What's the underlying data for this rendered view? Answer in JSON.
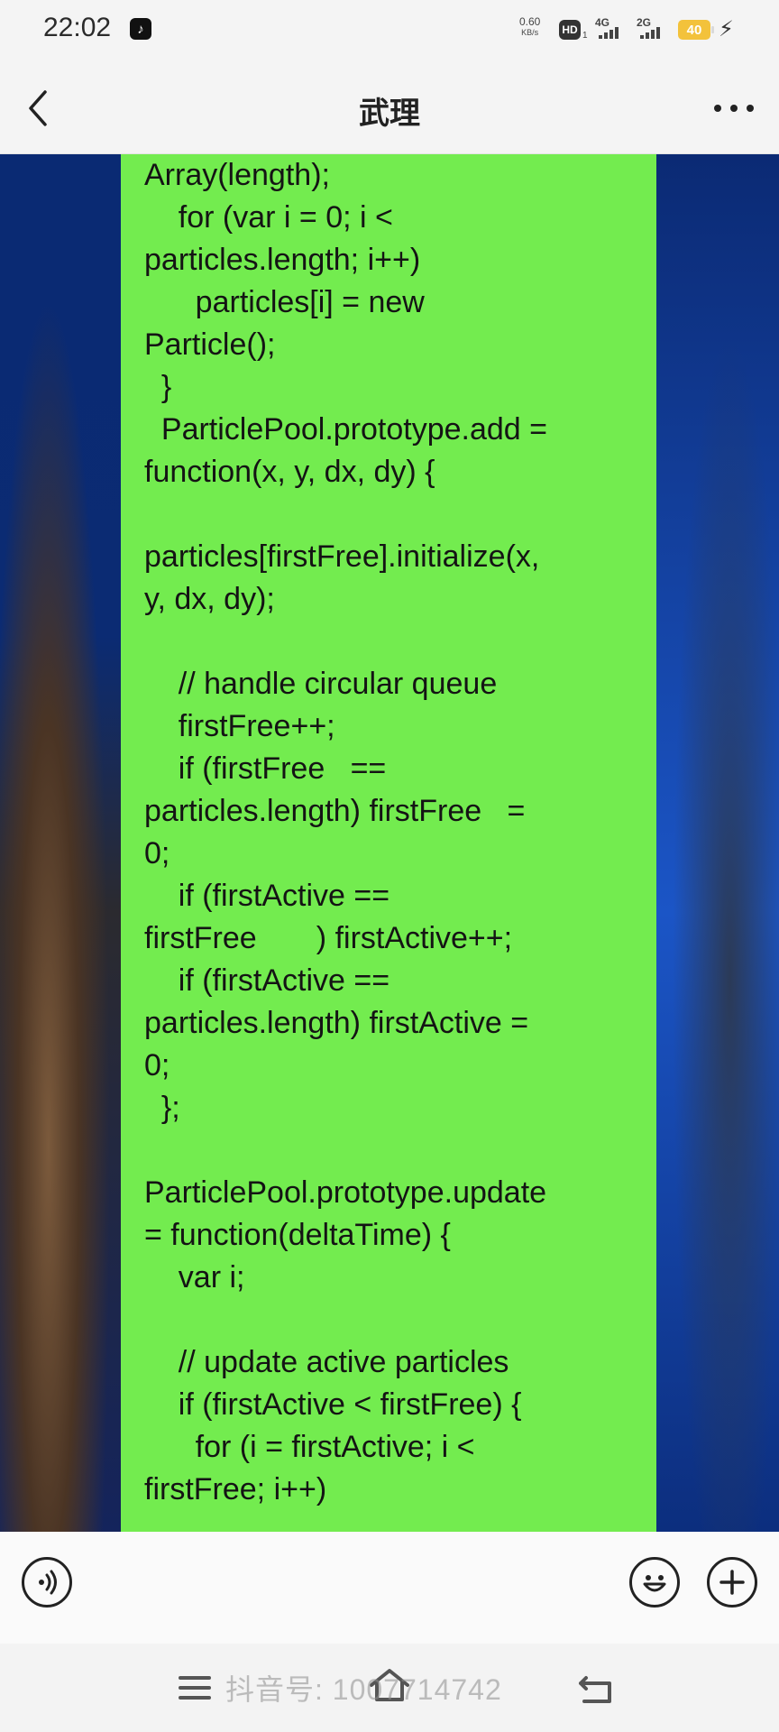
{
  "status_bar": {
    "time": "22:02",
    "net_speed_value": "0.60",
    "net_speed_unit": "KB/s",
    "hd_label": "HD",
    "hd_sub": "1",
    "signal1_label": "4G",
    "signal2_label": "2G",
    "battery_level": "40"
  },
  "header": {
    "title": "武理"
  },
  "content": {
    "code_lines": [
      "Array(length);",
      "    for (var i = 0; i <",
      "particles.length; i++)",
      "      particles[i] = new",
      "Particle();",
      "  }",
      "  ParticlePool.prototype.add =",
      "function(x, y, dx, dy) {",
      "",
      "particles[firstFree].initialize(x,",
      "y, dx, dy);",
      "",
      "    // handle circular queue",
      "    firstFree++;",
      "    if (firstFree   ==",
      "particles.length) firstFree   =",
      "0;",
      "    if (firstActive ==",
      "firstFree       ) firstActive++;",
      "    if (firstActive ==",
      "particles.length) firstActive =",
      "0;",
      "  };",
      "",
      "ParticlePool.prototype.update",
      "= function(deltaTime) {",
      "    var i;",
      "",
      "    // update active particles",
      "    if (firstActive < firstFree) {",
      "      for (i = firstActive; i <",
      "firstFree; i++)"
    ]
  },
  "watermark": "抖音号: 1007714742",
  "icons": {
    "back": "back-arrow-icon",
    "more": "more-dots-icon",
    "voice": "voice-icon",
    "emoji": "emoji-icon",
    "add": "plus-icon",
    "menu": "menu-icon",
    "home": "home-icon",
    "return": "return-icon"
  }
}
